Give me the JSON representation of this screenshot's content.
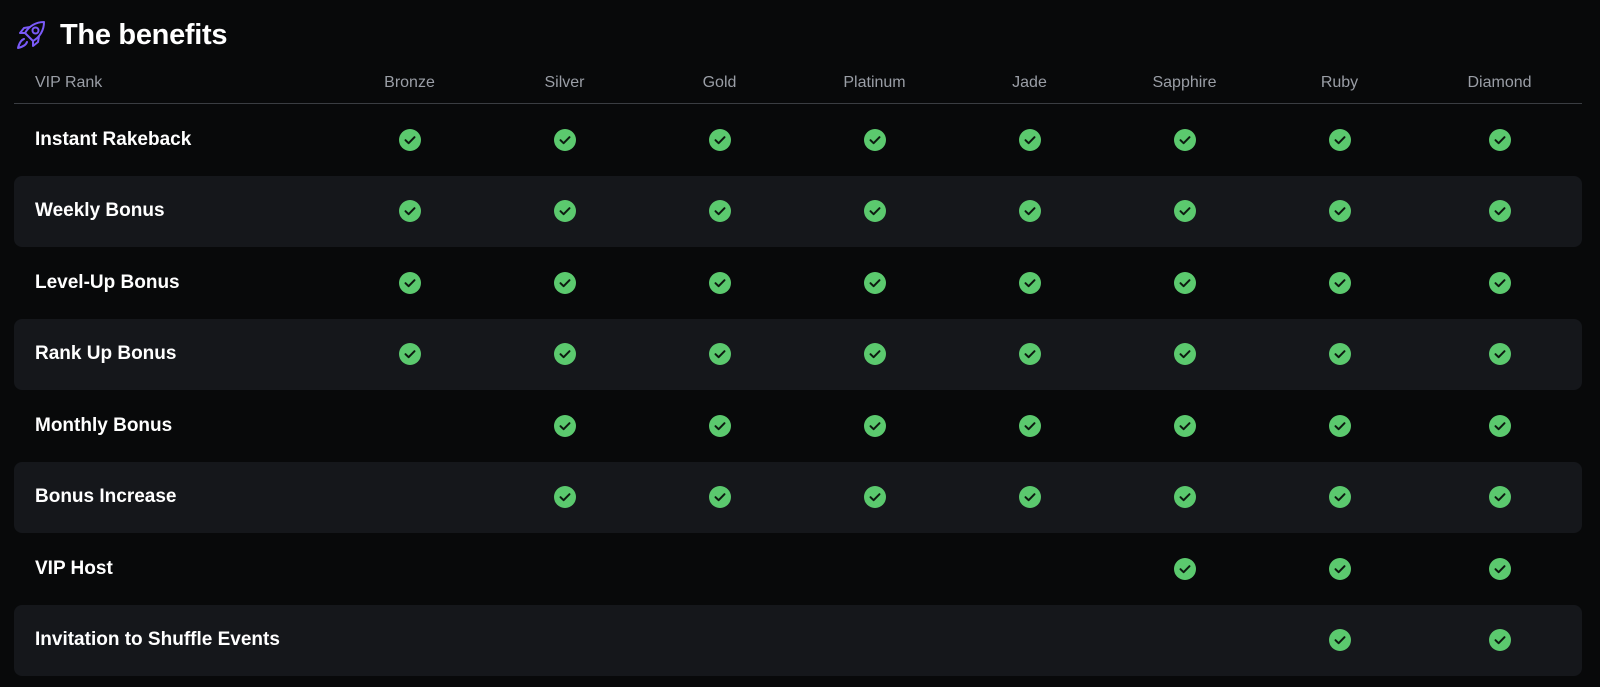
{
  "header": {
    "title": "The benefits",
    "icon": "rocket-icon",
    "icon_color": "#7a5af8"
  },
  "table": {
    "corner_label": "VIP Rank",
    "columns": [
      "Bronze",
      "Silver",
      "Gold",
      "Platinum",
      "Jade",
      "Sapphire",
      "Ruby",
      "Diamond"
    ],
    "check_color": "#5bc96e",
    "rows": [
      {
        "label": "Instant Rakeback",
        "checks": [
          true,
          true,
          true,
          true,
          true,
          true,
          true,
          true
        ]
      },
      {
        "label": "Weekly Bonus",
        "checks": [
          true,
          true,
          true,
          true,
          true,
          true,
          true,
          true
        ]
      },
      {
        "label": "Level-Up Bonus",
        "checks": [
          true,
          true,
          true,
          true,
          true,
          true,
          true,
          true
        ]
      },
      {
        "label": "Rank Up Bonus",
        "checks": [
          true,
          true,
          true,
          true,
          true,
          true,
          true,
          true
        ]
      },
      {
        "label": "Monthly Bonus",
        "checks": [
          false,
          true,
          true,
          true,
          true,
          true,
          true,
          true
        ]
      },
      {
        "label": "Bonus Increase",
        "checks": [
          false,
          true,
          true,
          true,
          true,
          true,
          true,
          true
        ]
      },
      {
        "label": "VIP Host",
        "checks": [
          false,
          false,
          false,
          false,
          false,
          true,
          true,
          true
        ]
      },
      {
        "label": "Invitation to Shuffle Events",
        "checks": [
          false,
          false,
          false,
          false,
          false,
          false,
          true,
          true
        ]
      }
    ]
  }
}
